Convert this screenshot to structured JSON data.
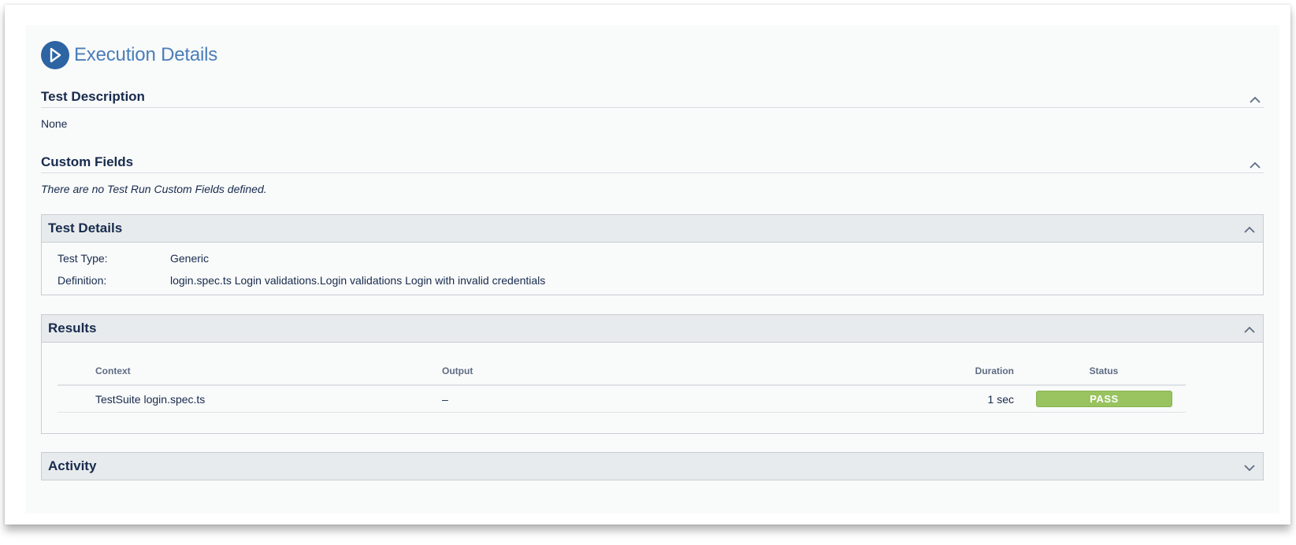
{
  "page": {
    "title": "Execution Details",
    "icon": "play-circle-icon",
    "accent_color": "#2d64a3"
  },
  "test_description": {
    "heading": "Test Description",
    "value": "None"
  },
  "custom_fields": {
    "heading": "Custom Fields",
    "message": "There are no Test Run Custom Fields defined."
  },
  "test_details": {
    "heading": "Test Details",
    "rows": [
      {
        "label": "Test Type:",
        "value": "Generic"
      },
      {
        "label": "Definition:",
        "value": "login.spec.ts Login validations.Login validations Login with invalid credentials"
      }
    ]
  },
  "results": {
    "heading": "Results",
    "columns": {
      "context": "Context",
      "output": "Output",
      "duration": "Duration",
      "status": "Status"
    },
    "rows": [
      {
        "context": "TestSuite login.spec.ts",
        "output": "–",
        "duration": "1 sec",
        "status": "PASS",
        "status_color": "#98c35f"
      }
    ]
  },
  "activity": {
    "heading": "Activity"
  }
}
